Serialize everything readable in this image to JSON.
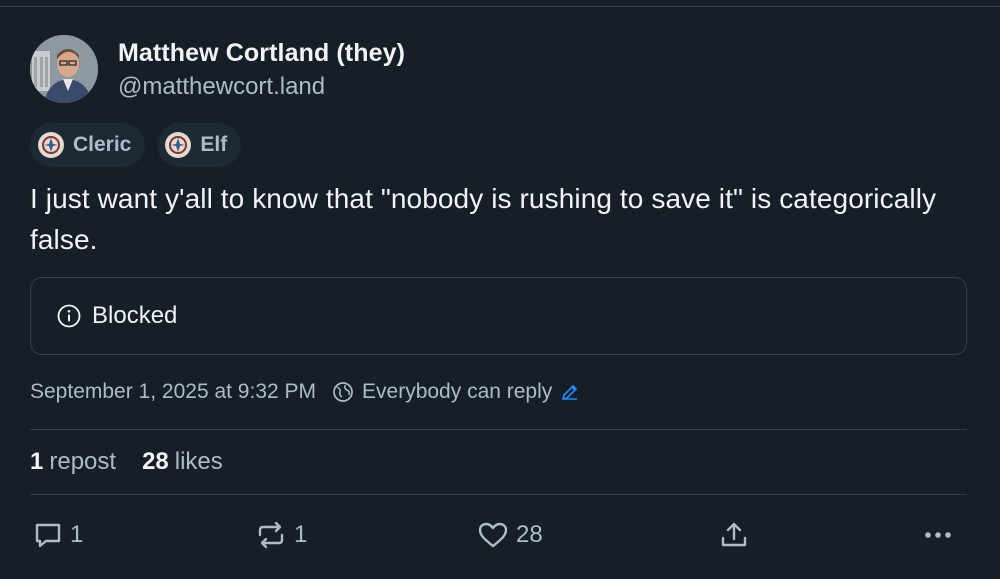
{
  "author": {
    "display_name": "Matthew Cortland (they)",
    "handle": "@matthewcort.land"
  },
  "labels": [
    {
      "text": "Cleric",
      "icon": "labeler-badge-icon"
    },
    {
      "text": "Elf",
      "icon": "labeler-badge-icon"
    }
  ],
  "post": {
    "text": "I just want y'all to know that \"nobody is rushing to save it\" is categorically false."
  },
  "embed": {
    "status": "Blocked",
    "icon": "info-icon"
  },
  "meta": {
    "timestamp": "September 1, 2025 at 9:32 PM",
    "reply_setting": "Everybody can reply",
    "reply_icon": "globe-icon",
    "edit_icon": "pencil-icon"
  },
  "stats": {
    "reposts": "1",
    "reposts_label": "repost",
    "likes": "28",
    "likes_label": "likes"
  },
  "actions": {
    "reply_count": "1",
    "repost_count": "1",
    "like_count": "28"
  },
  "colors": {
    "background": "#161e27",
    "text_primary": "#f1f3f5",
    "text_secondary": "#aebbc9",
    "accent": "#208bfe",
    "border": "#2e4052"
  }
}
